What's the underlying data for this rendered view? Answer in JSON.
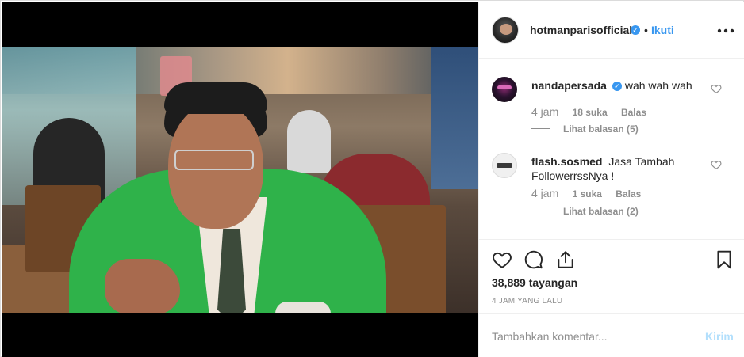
{
  "header": {
    "username": "hotmanparisofficial",
    "separator": "•",
    "follow_label": "Ikuti",
    "more_label": "•••"
  },
  "comments": [
    {
      "username": "nandapersada",
      "verified": true,
      "text": "wah wah wah",
      "time": "4 jam",
      "likes": "18 suka",
      "reply_label": "Balas",
      "view_replies": "Lihat balasan (5)"
    },
    {
      "username": "flash.sosmed",
      "verified": false,
      "text": "Jasa Tambah FollowerrssNya !",
      "time": "4 jam",
      "likes": "1 suka",
      "reply_label": "Balas",
      "view_replies": "Lihat balasan (2)"
    }
  ],
  "actions": {
    "views": "38,889 tayangan",
    "posted_ago": "4 JAM YANG LALU"
  },
  "add_comment": {
    "placeholder": "Tambahkan komentar...",
    "post_label": "Kirim"
  },
  "colors": {
    "link": "#3897f0",
    "post_disabled": "#b2dffc",
    "secondary_text": "#8e8e8e"
  },
  "icons": {
    "verified": "verified-badge-icon",
    "like": "heart-icon",
    "comment": "comment-icon",
    "share": "share-icon",
    "save": "bookmark-icon"
  }
}
